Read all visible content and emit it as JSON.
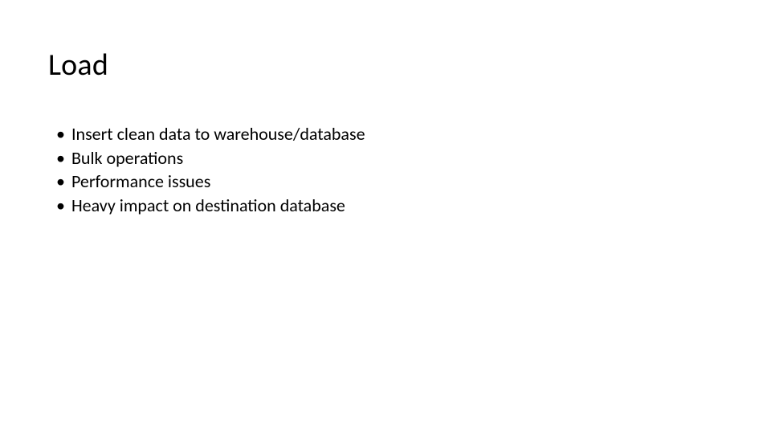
{
  "slide": {
    "title": "Load",
    "bullets": [
      "Insert clean data to warehouse/database",
      "Bulk operations",
      "Performance issues",
      "Heavy impact on destination database"
    ]
  }
}
